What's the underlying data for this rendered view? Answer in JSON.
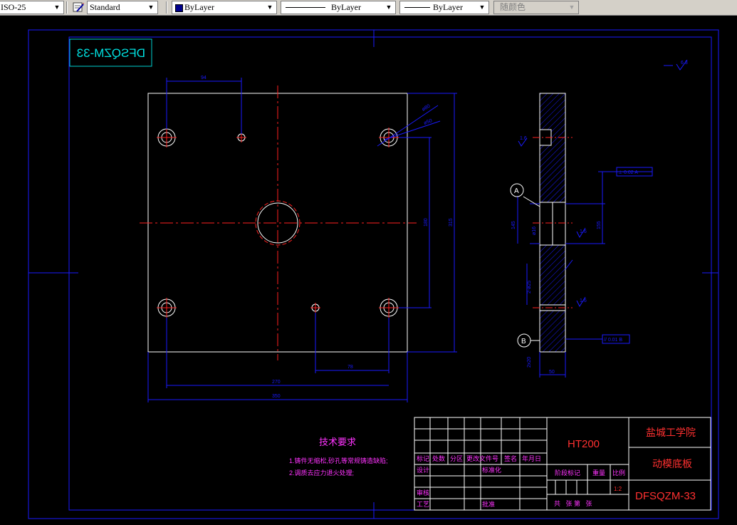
{
  "toolbar": {
    "dimstyle": "ISO-25",
    "textstyle": "Standard",
    "layer": "ByLayer",
    "linetype": "ByLayer",
    "lineweight": "ByLayer",
    "plotstyle": "随颜色"
  },
  "drawing": {
    "mirrored_code": "DFSQZM-33",
    "roughness_top": "6.3",
    "dims": {
      "d94": "94",
      "phi80": "ø80",
      "phi50": "ø50",
      "d180": "180",
      "d315": "315",
      "d270": "270",
      "d350": "350",
      "d78": "78",
      "side_width": "50",
      "side_145": "145",
      "side_155": "155",
      "side_phi16": "ø16",
      "side_phi25": "2-ø25",
      "side_2x20": "2x20",
      "side_ra": "1.6",
      "gdt_top": "⊥ 0.02 A",
      "gdt_bottom": "// 0.01 B",
      "datum_a": "A",
      "datum_b": "B"
    }
  },
  "tech": {
    "title": "技术要求",
    "line1": "1.铸件无缩松,砂孔等常规铸造缺陷;",
    "line2": "2.调质去应力退火处理;"
  },
  "titleblock": {
    "h_mark": "标记",
    "h_count": "处数",
    "h_zone": "分区",
    "h_docno": "更改文件号",
    "h_sign": "签名",
    "h_date": "年月日",
    "designer": "设计",
    "standard": "标准化",
    "checker": "审核",
    "process": "工艺",
    "approve": "批准",
    "stage": "阶段标记",
    "weight": "重量",
    "scale_label": "比例",
    "scale_value": "1:2",
    "sheets": "共   张 第   张",
    "material": "HT200",
    "school": "盐城工学院",
    "part_name": "动模底板",
    "code": "DFSQZM-33"
  }
}
